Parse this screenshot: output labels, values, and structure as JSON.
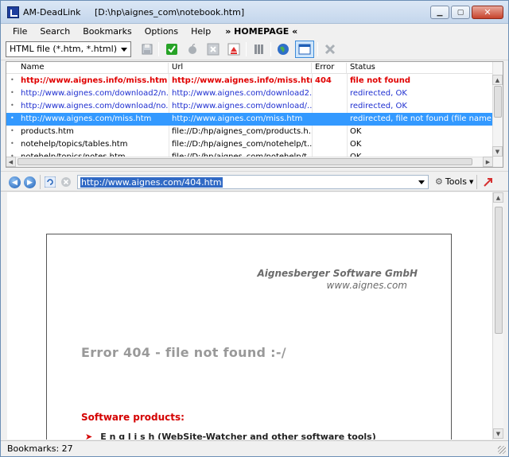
{
  "window": {
    "title": "AM-DeadLink     [D:\\hp\\aignes_com\\notebook.htm]"
  },
  "menu": {
    "items": [
      "File",
      "Search",
      "Bookmarks",
      "Options",
      "Help"
    ],
    "homepage": "» HOMEPAGE «"
  },
  "toolbar": {
    "filetype": "HTML file (*.htm, *.html)",
    "icons": [
      "save-icon",
      "checkmark-icon",
      "apple-icon",
      "close-icon",
      "homepage-icon",
      "columns-icon",
      "globe-icon",
      "browser-window-icon",
      "delete-icon"
    ]
  },
  "table": {
    "columns": [
      "Name",
      "Url",
      "Error",
      "Status"
    ],
    "rows": [
      {
        "name": "http://www.aignes.info/miss.htm",
        "url": "http://www.aignes.info/miss.htm",
        "error": "404",
        "status": "file not found",
        "kind": "error"
      },
      {
        "name": "http://www.aignes.com/download2/n...",
        "url": "http://www.aignes.com/download2...",
        "error": "",
        "status": "redirected, OK",
        "kind": "redirect"
      },
      {
        "name": "http://www.aignes.com/download/no...",
        "url": "http://www.aignes.com/download/...",
        "error": "",
        "status": "redirected, OK",
        "kind": "redirect"
      },
      {
        "name": "http://www.aignes.com/miss.htm",
        "url": "http://www.aignes.com/miss.htm",
        "error": "",
        "status": "redirected, file not found (file name / ...",
        "kind": "selected"
      },
      {
        "name": "products.htm",
        "url": "file://D:/hp/aignes_com/products.h...",
        "error": "",
        "status": "OK",
        "kind": "ok"
      },
      {
        "name": "notehelp/topics/tables.htm",
        "url": "file://D:/hp/aignes_com/notehelp/t...",
        "error": "",
        "status": "OK",
        "kind": "ok"
      },
      {
        "name": "notehelp/topics/notes.htm",
        "url": "file://D:/hp/aignes_com/notehelp/t...",
        "error": "",
        "status": "OK",
        "kind": "ok"
      }
    ]
  },
  "browser": {
    "url": "http://www.aignes.com/404.htm",
    "tools_label": "Tools"
  },
  "page": {
    "company": "Aignesberger Software GmbH",
    "company_url": "www.aignes.com",
    "error_heading": "Error 404 - file not found  :-/",
    "products_heading": "Software products:",
    "first_product": "E n g l i s h  (WebSite-Watcher and other software tools)"
  },
  "status": {
    "bookmarks": "Bookmarks: 27"
  },
  "colors": {
    "error_red": "#e00000",
    "link_blue": "#1f2fd0",
    "status_blue": "#1f2fd0",
    "selection": "#3399ff"
  }
}
